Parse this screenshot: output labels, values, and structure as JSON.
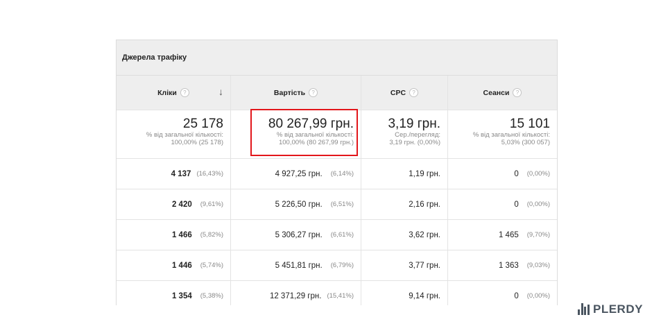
{
  "title": "Джерела трафіку",
  "columns": [
    {
      "label": "Кліки",
      "help": "?"
    },
    {
      "label": "Вартість",
      "help": "?"
    },
    {
      "label": "CPC",
      "help": "?"
    },
    {
      "label": "Сеанси",
      "help": "?"
    }
  ],
  "sort_icon": "↓",
  "totals": [
    {
      "value": "25 178",
      "note1": "% від загальної кількості:",
      "note2": "100,00% (25 178)"
    },
    {
      "value": "80 267,99 грн.",
      "note1": "% від загальної кількості:",
      "note2": "100,00% (80 267,99 грн.)"
    },
    {
      "value": "3,19 грн.",
      "note1": "Сер./перегляд:",
      "note2": "3,19 грн. (0,00%)"
    },
    {
      "value": "15 101",
      "note1": "% від загальної кількості:",
      "note2": "5,03% (300 057)"
    }
  ],
  "rows": [
    {
      "clicks": "4 137",
      "clicks_pct": "(16,43%)",
      "cost": "4 927,25 грн.",
      "cost_pct": "(6,14%)",
      "cpc": "1,19 грн.",
      "sessions": "0",
      "sessions_pct": "(0,00%)"
    },
    {
      "clicks": "2 420",
      "clicks_pct": "(9,61%)",
      "cost": "5 226,50 грн.",
      "cost_pct": "(6,51%)",
      "cpc": "2,16 грн.",
      "sessions": "0",
      "sessions_pct": "(0,00%)"
    },
    {
      "clicks": "1 466",
      "clicks_pct": "(5,82%)",
      "cost": "5 306,27 грн.",
      "cost_pct": "(6,61%)",
      "cpc": "3,62 грн.",
      "sessions": "1 465",
      "sessions_pct": "(9,70%)"
    },
    {
      "clicks": "1 446",
      "clicks_pct": "(5,74%)",
      "cost": "5 451,81 грн.",
      "cost_pct": "(6,79%)",
      "cpc": "3,77 грн.",
      "sessions": "1 363",
      "sessions_pct": "(9,03%)"
    },
    {
      "clicks": "1 354",
      "clicks_pct": "(5,38%)",
      "cost": "12 371,29 грн.",
      "cost_pct": "(15,41%)",
      "cpc": "9,14 грн.",
      "sessions": "0",
      "sessions_pct": "(0,00%)"
    }
  ],
  "brand": {
    "name": "PLERDY",
    "icon": "bar-chart-icon",
    "color": "#4a5560"
  },
  "highlight_color": "#e2161b"
}
